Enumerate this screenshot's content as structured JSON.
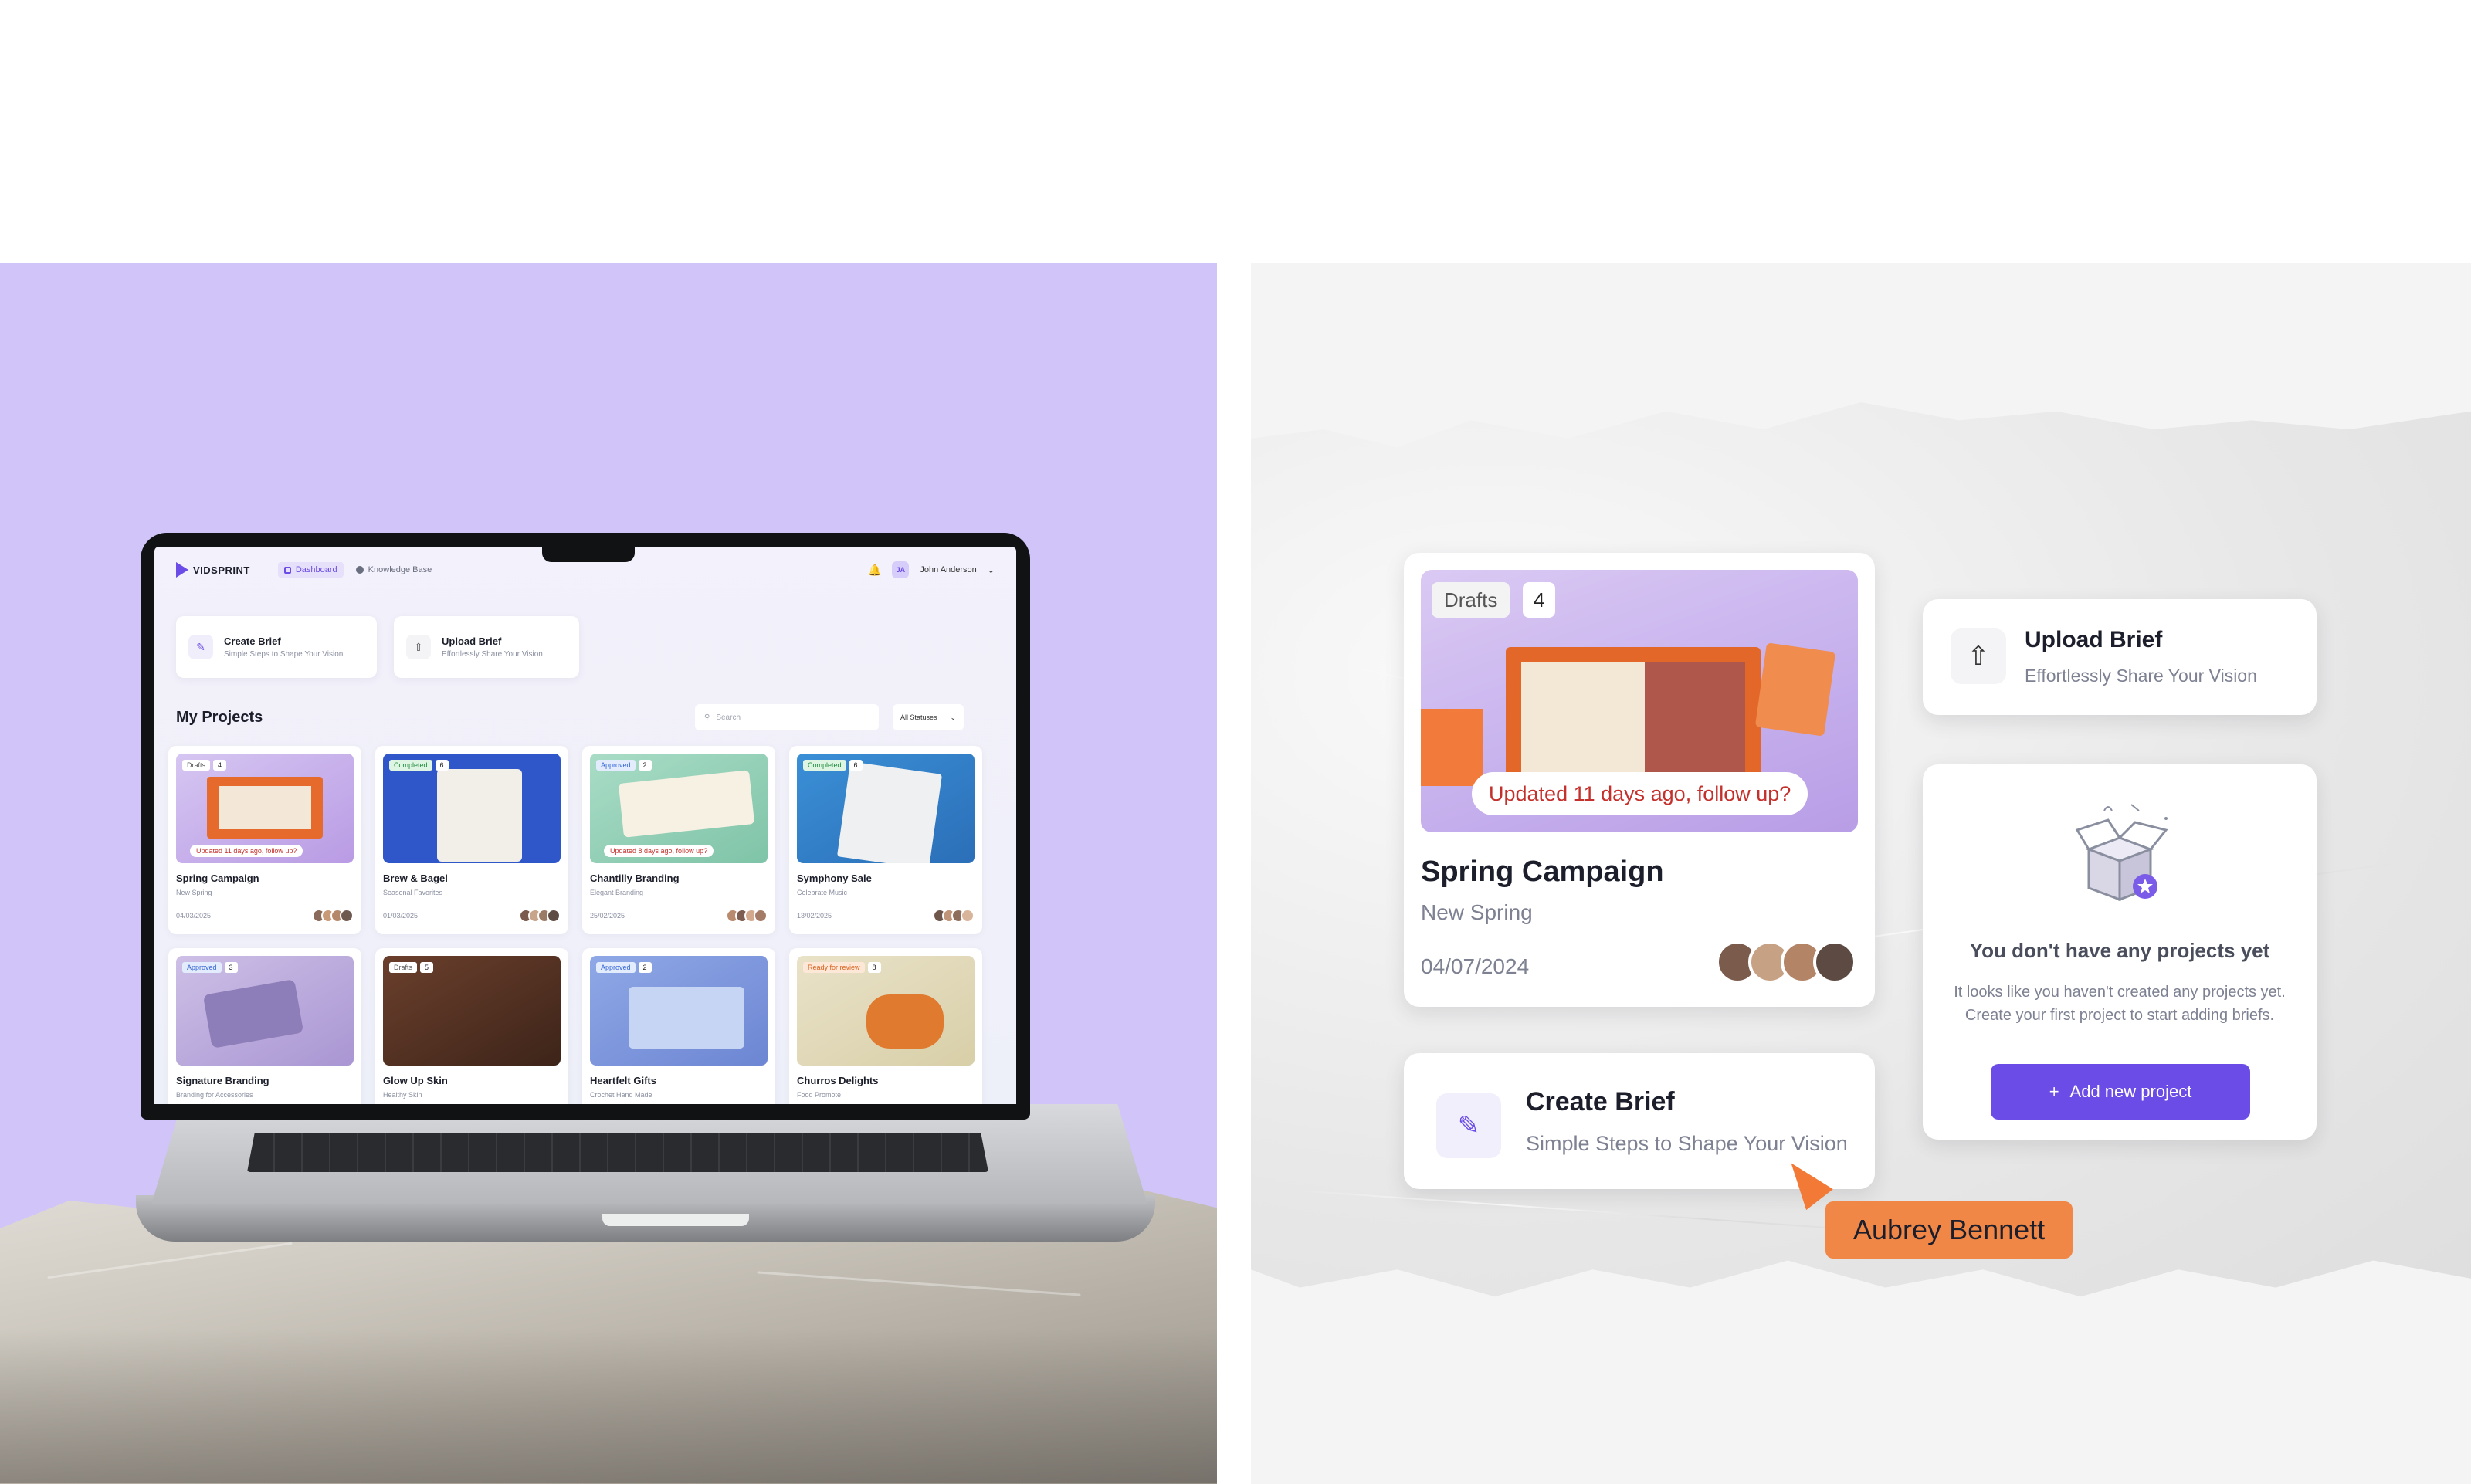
{
  "laptop_app": {
    "brand": "VIDSPRINT",
    "nav": {
      "dashboard": "Dashboard",
      "knowledge_base": "Knowledge Base",
      "user_initials": "JA",
      "user_name": "John Anderson"
    },
    "actions": [
      {
        "title": "Create Brief",
        "subtitle": "Simple Steps to Shape Your Vision"
      },
      {
        "title": "Upload Brief",
        "subtitle": "Effortlessly Share Your Vision"
      }
    ],
    "section_title": "My Projects",
    "search_placeholder": "Search",
    "status_filter": "All Statuses",
    "projects": [
      {
        "title": "Spring Campaign",
        "subtitle": "New Spring",
        "date": "04/03/2025",
        "status": "Drafts",
        "count": "4",
        "note": "Updated 11 days ago, follow up?"
      },
      {
        "title": "Brew & Bagel",
        "subtitle": "Seasonal Favorites",
        "date": "01/03/2025",
        "status": "Completed",
        "count": "6",
        "note": ""
      },
      {
        "title": "Chantilly Branding",
        "subtitle": "Elegant Branding",
        "date": "25/02/2025",
        "status": "Approved",
        "count": "2",
        "note": "Updated 8 days ago, follow up?"
      },
      {
        "title": "Symphony Sale",
        "subtitle": "Celebrate Music",
        "date": "13/02/2025",
        "status": "Completed",
        "count": "6",
        "note": ""
      },
      {
        "title": "Signature Branding",
        "subtitle": "Branding for Accessories",
        "date": "",
        "status": "Approved",
        "count": "3",
        "note": ""
      },
      {
        "title": "Glow Up Skin",
        "subtitle": "Healthy Skin",
        "date": "",
        "status": "Drafts",
        "count": "5",
        "note": ""
      },
      {
        "title": "Heartfelt Gifts",
        "subtitle": "Crochet Hand Made",
        "date": "",
        "status": "Approved",
        "count": "2",
        "note": ""
      },
      {
        "title": "Churros Delights",
        "subtitle": "Food Promote",
        "date": "",
        "status": "Ready for review",
        "count": "8",
        "note": ""
      }
    ]
  },
  "showcase": {
    "project_card": {
      "status": "Drafts",
      "count": "4",
      "note": "Updated 11 days ago, follow up?",
      "title": "Spring Campaign",
      "subtitle": "New Spring",
      "date": "04/07/2024"
    },
    "upload_brief": {
      "title": "Upload Brief",
      "subtitle": "Effortlessly Share Your Vision"
    },
    "create_brief": {
      "title": "Create Brief",
      "subtitle": "Simple Steps to Shape Your Vision"
    },
    "empty_state": {
      "title": "You don't have any projects yet",
      "text_line1": "It looks like you haven't created any projects yet.",
      "text_line2": "Create your first project to start adding briefs.",
      "button": "Add new project"
    },
    "collaborator": "Aubrey Bennett"
  },
  "colors": {
    "accent": "#6b4ce6",
    "left_background": "#d0c4f8",
    "cursor": "#f27a36",
    "note_text": "#c4302b"
  },
  "icons": [
    "vidsprint-logo-icon",
    "dashboard-icon",
    "knowledge-base-icon",
    "bell-icon",
    "chevron-down-icon",
    "magic-wand-icon",
    "upload-cloud-icon",
    "search-icon",
    "empty-box-icon",
    "plus-icon",
    "cursor-icon"
  ]
}
